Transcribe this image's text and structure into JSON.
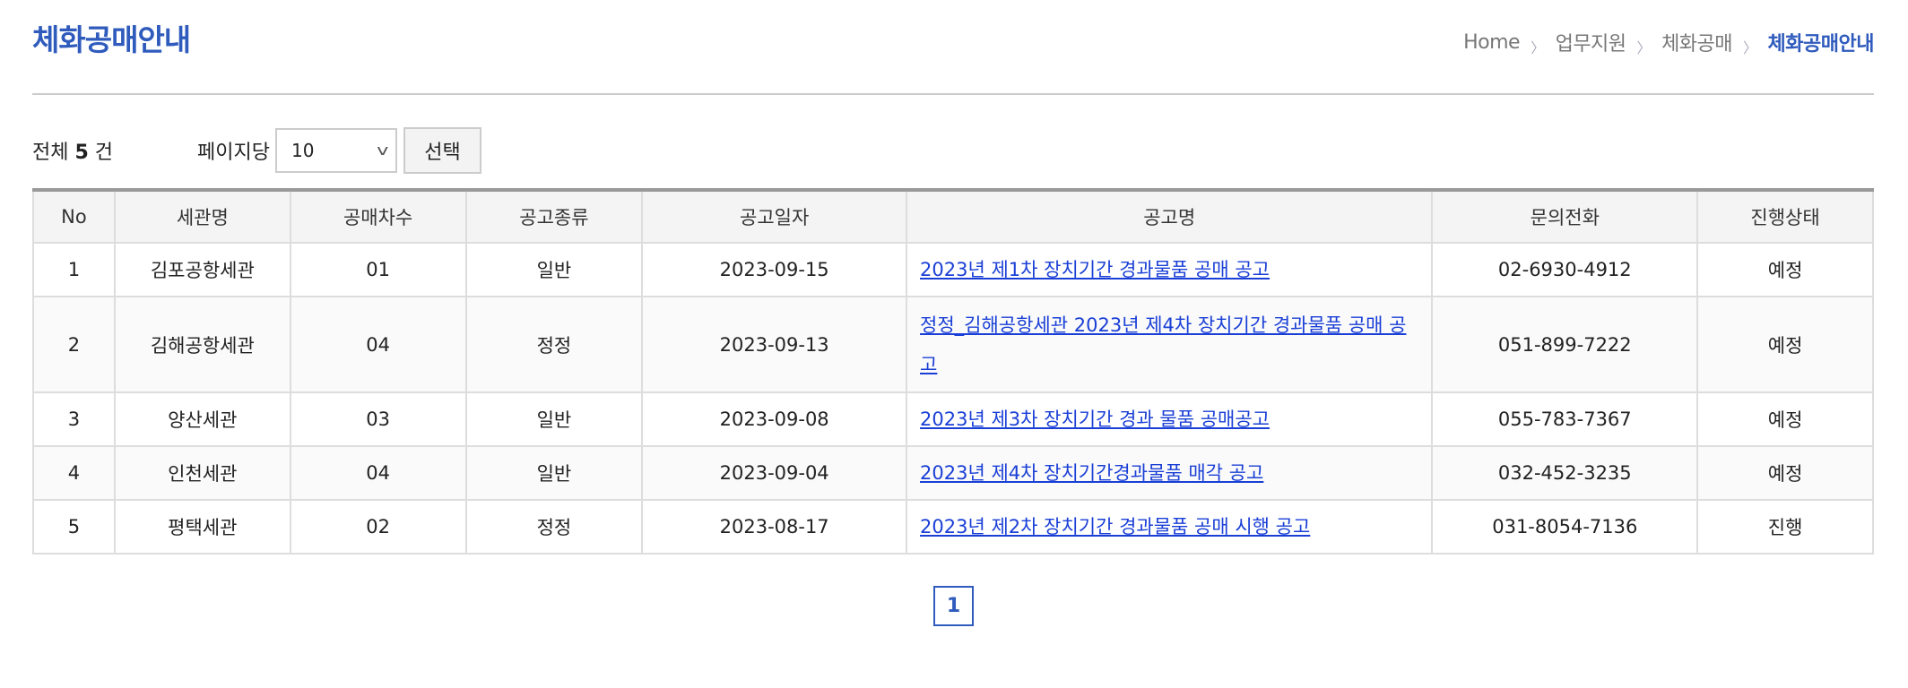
{
  "header": {
    "title": "체화공매안내"
  },
  "breadcrumb": [
    "Home",
    "업무지원",
    "체화공매",
    "체화공매안내"
  ],
  "toolbar": {
    "total_prefix": "전체",
    "total_count": "5",
    "total_suffix": "건",
    "per_page_label": "페이지당",
    "per_page_value": "10",
    "select_button": "선택"
  },
  "table": {
    "headers": [
      "No",
      "세관명",
      "공매차수",
      "공고종류",
      "공고일자",
      "공고명",
      "문의전화",
      "진행상태"
    ],
    "rows": [
      [
        "1",
        "김포공항세관",
        "01",
        "일반",
        "2023-09-15",
        "2023년 제1차 장치기간 경과물품 공매 공고",
        "02-6930-4912",
        "예정"
      ],
      [
        "2",
        "김해공항세관",
        "04",
        "정정",
        "2023-09-13",
        "정정_김해공항세관 2023년 제4차 장치기간 경과물품 공매 공고",
        "051-899-7222",
        "예정"
      ],
      [
        "3",
        "양산세관",
        "03",
        "일반",
        "2023-09-08",
        "2023년 제3차 장치기간 경과 물품 공매공고",
        "055-783-7367",
        "예정"
      ],
      [
        "4",
        "인천세관",
        "04",
        "일반",
        "2023-09-04",
        "2023년 제4차 장치기간경과물품 매각 공고",
        "032-452-3235",
        "예정"
      ],
      [
        "5",
        "평택세관",
        "02",
        "정정",
        "2023-08-17",
        "2023년 제2차 장치기간 경과물품 공매 시행 공고",
        "031-8054-7136",
        "진행"
      ]
    ]
  },
  "pagination": {
    "current": "1"
  },
  "colors": {
    "accent": "#2f5bbd",
    "link": "#1a3fd6"
  }
}
